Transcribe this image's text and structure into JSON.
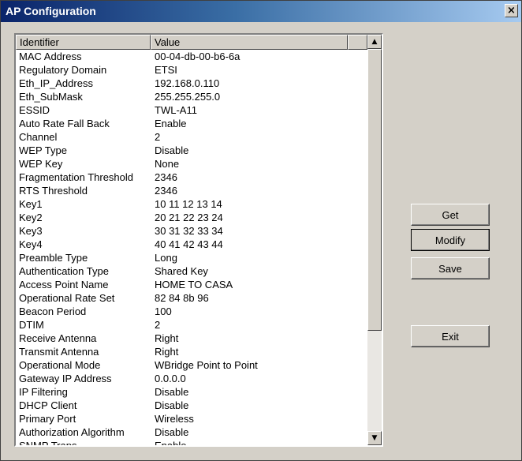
{
  "window": {
    "title": "AP Configuration",
    "close_label": "×"
  },
  "listview": {
    "columns": [
      "Identifier",
      "Value"
    ],
    "rows": [
      [
        "MAC Address",
        "00-04-db-00-b6-6a"
      ],
      [
        "Regulatory Domain",
        "ETSI"
      ],
      [
        "Eth_IP_Address",
        "192.168.0.110"
      ],
      [
        "Eth_SubMask",
        "255.255.255.0"
      ],
      [
        "ESSID",
        "TWL-A11"
      ],
      [
        "Auto Rate Fall Back",
        "Enable"
      ],
      [
        "Channel",
        "2"
      ],
      [
        "WEP Type",
        "Disable"
      ],
      [
        "WEP Key",
        "None"
      ],
      [
        "Fragmentation Threshold",
        "2346"
      ],
      [
        "RTS Threshold",
        "2346"
      ],
      [
        "Key1",
        "10 11 12 13 14"
      ],
      [
        "Key2",
        "20 21 22 23 24"
      ],
      [
        "Key3",
        "30 31 32 33 34"
      ],
      [
        "Key4",
        "40 41 42 43 44"
      ],
      [
        "Preamble Type",
        "Long"
      ],
      [
        "Authentication Type",
        "Shared Key"
      ],
      [
        "Access Point Name",
        "HOME TO CASA"
      ],
      [
        "Operational Rate Set",
        "82 84 8b 96"
      ],
      [
        "Beacon Period",
        "100"
      ],
      [
        "DTIM",
        "2"
      ],
      [
        "Receive Antenna",
        "Right"
      ],
      [
        "Transmit Antenna",
        "Right"
      ],
      [
        "Operational Mode",
        "WBridge Point to Point"
      ],
      [
        "Gateway IP Address",
        "0.0.0.0"
      ],
      [
        "IP Filtering",
        "Disable"
      ],
      [
        "DHCP Client",
        "Disable"
      ],
      [
        "Primary Port",
        "Wireless"
      ],
      [
        "Authorization Algorithm",
        "Disable"
      ],
      [
        "SNMP Traps",
        "Enable"
      ]
    ],
    "scroll_up_icon": "▲",
    "scroll_down_icon": "▼"
  },
  "buttons": {
    "get": "Get",
    "modify": "Modify",
    "save": "Save",
    "exit": "Exit"
  }
}
